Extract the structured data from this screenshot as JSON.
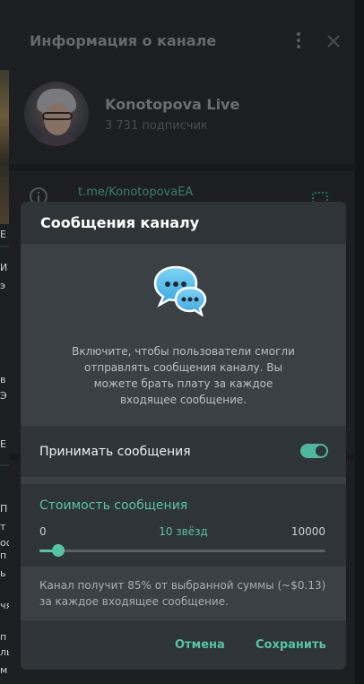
{
  "panel": {
    "title": "Информация о канале",
    "channel_name": "Konotopova Live",
    "subscribers": "3 731 подписчик",
    "link": "t.me/KonotopovaEA"
  },
  "background_strip": {
    "chars": [
      "Е",
      "И",
      "э",
      "в",
      "Э",
      "Е",
      "П",
      "т",
      "ос",
      "п",
      "ь",
      "чя",
      "п",
      "ль",
      "м"
    ]
  },
  "modal": {
    "title": "Сообщения каналу",
    "description": "Включите, чтобы пользователи смогли отправлять сообщения каналу. Вы можете брать плату за каждое входящее сообщение.",
    "toggle_label": "Принимать сообщения",
    "toggle_on": true,
    "cost": {
      "title": "Стоимость сообщения",
      "min_label": "0",
      "max_label": "10000",
      "value_label": "10 звёзд",
      "value": 10,
      "min": 0,
      "max": 10000
    },
    "note": "Канал получит 85% от выбранной суммы (~$0.13) за каждое входящее сообщение.",
    "cancel_label": "Отмена",
    "save_label": "Сохранить"
  },
  "colors": {
    "accent": "#55c3a8",
    "modal_bg": "#2f3438",
    "section_bg": "#3a4044"
  },
  "icons": [
    "menu-icon",
    "close-icon",
    "info-icon",
    "qr-icon",
    "chat-bubbles-icon"
  ]
}
